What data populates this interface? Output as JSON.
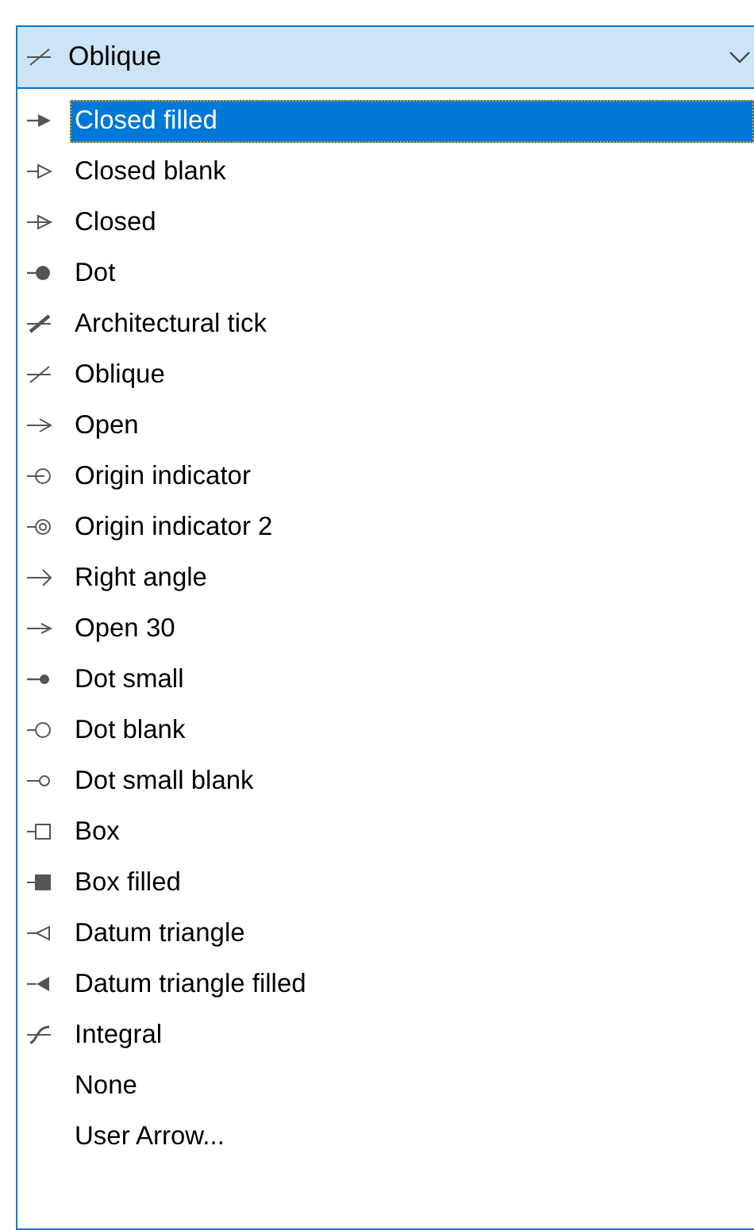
{
  "combo": {
    "kind": "oblique",
    "value": "Oblique"
  },
  "options": [
    {
      "label": "Closed filled",
      "kind": "closed-filled",
      "selected": true
    },
    {
      "label": "Closed blank",
      "kind": "closed-blank",
      "selected": false
    },
    {
      "label": "Closed",
      "kind": "closed",
      "selected": false
    },
    {
      "label": "Dot",
      "kind": "dot",
      "selected": false
    },
    {
      "label": "Architectural tick",
      "kind": "tick",
      "selected": false
    },
    {
      "label": "Oblique",
      "kind": "oblique",
      "selected": false
    },
    {
      "label": "Open",
      "kind": "open",
      "selected": false
    },
    {
      "label": "Origin indicator",
      "kind": "origin",
      "selected": false
    },
    {
      "label": "Origin indicator 2",
      "kind": "origin2",
      "selected": false
    },
    {
      "label": "Right angle",
      "kind": "right-angle",
      "selected": false
    },
    {
      "label": "Open 30",
      "kind": "open30",
      "selected": false
    },
    {
      "label": "Dot small",
      "kind": "dot-small",
      "selected": false
    },
    {
      "label": "Dot blank",
      "kind": "dot-blank",
      "selected": false
    },
    {
      "label": "Dot small blank",
      "kind": "dot-small-blank",
      "selected": false
    },
    {
      "label": "Box",
      "kind": "box",
      "selected": false
    },
    {
      "label": "Box filled",
      "kind": "box-filled",
      "selected": false
    },
    {
      "label": "Datum triangle",
      "kind": "datum",
      "selected": false
    },
    {
      "label": "Datum triangle filled",
      "kind": "datum-filled",
      "selected": false
    },
    {
      "label": "Integral",
      "kind": "integral",
      "selected": false
    },
    {
      "label": "None",
      "kind": "none",
      "selected": false
    },
    {
      "label": "User Arrow...",
      "kind": "none",
      "selected": false
    }
  ]
}
